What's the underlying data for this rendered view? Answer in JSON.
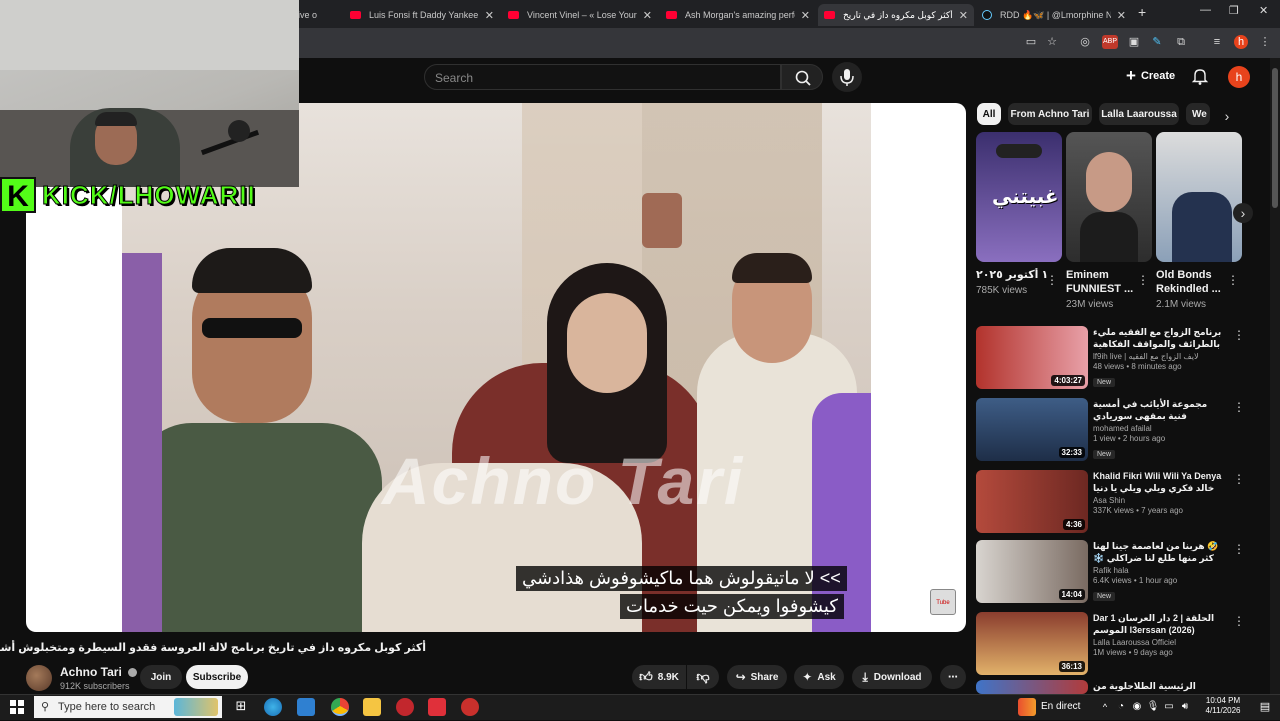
{
  "browser": {
    "tabs": [
      {
        "label": "ive o",
        "icon": "youtube-icon"
      },
      {
        "label": "Luis Fonsi ft Daddy Yankee – D",
        "icon": "youtube-icon"
      },
      {
        "label": "Vincent Vinel – « Lose Yourself",
        "icon": "youtube-icon"
      },
      {
        "label": "Ash Morgan's amazing perform",
        "icon": "youtube-icon"
      },
      {
        "label": "أكثر كوبل مكروه داز في تاريخ",
        "icon": "youtube-icon",
        "active": true
      },
      {
        "label": "RDD 🔥🦋 | @Lmorphine Next",
        "icon": "tiktok-icon"
      }
    ],
    "new_tab": "+",
    "window_controls": {
      "minimize": "—",
      "maximize": "❐",
      "close": "✕"
    }
  },
  "youtube": {
    "search_placeholder": "Search",
    "create_label": "Create",
    "avatar_letter": "h"
  },
  "webcam": {
    "kick_logo": "K",
    "kick_text": "KICK/LHOWARII"
  },
  "player": {
    "watermark": "Achno Tari",
    "subtitle_line1": ">> لا ماتيقولوش هما ماكيشوفوش هذادشي",
    "subtitle_line2": "كيشوفوا ويمكن حيت خدمات",
    "badge": "Tube"
  },
  "video": {
    "title": "أكثر كوبل مكروه داز في تاريخ برنامج لالة العروسة فقدو السيطرة ومتخبلوش أشنو داروا",
    "channel": "Achno Tari",
    "subscribers": "912K subscribers",
    "join_label": "Join",
    "subscribe_label": "Subscribe",
    "likes": "8.9K",
    "share_label": "Share",
    "ask_label": "Ask",
    "download_label": "Download",
    "more_label": "⋯"
  },
  "chips": [
    "All",
    "From Achno Tari",
    "Lalla Laaroussa",
    "We"
  ],
  "shorts": [
    {
      "thumb_text": "غبيتني",
      "title": "١ أكتوبر ٢٠٢٥",
      "views": "785K views"
    },
    {
      "title": "Eminem FUNNIEST ...",
      "views": "23M views"
    },
    {
      "title": "Old Bonds Rekindled ...",
      "views": "2.1M views"
    }
  ],
  "recommendations": [
    {
      "title": "برنامج الزواج مع الفقيه مليء بالطرائف والمواقف الفكاهية",
      "channel": "lf9ih live | لايف الزواج مع الفقيه",
      "views": "48 views • 8 minutes ago",
      "duration": "4:03:27",
      "badge": "New"
    },
    {
      "title": "مجموعة الأيائب في أمسية فنية بمقهى سوريادي الثقافي تطوان",
      "channel": "mohamed afailal",
      "views": "1 view • 2 hours ago",
      "duration": "32:33",
      "badge": "New"
    },
    {
      "title": "Khalid Fikri Wili Wili Ya Denya خالد فكري ويلي ويلي يا دنيا",
      "channel": "Asa Shin",
      "views": "337K views • 7 years ago",
      "duration": "4:36",
      "badge": ""
    },
    {
      "title": "🤣 هربنا من لعاصمة جينا لهنا كثر منها طلع لنا ضراكلي ❄️",
      "channel": "Rafik hala",
      "views": "6.4K views • 1 hour ago",
      "duration": "14:04",
      "badge": "New"
    },
    {
      "title": "Dar 1 الحلقة | 2 دار العرسان الموسم l3erssan (2026)",
      "channel": "Lalla Laaroussa Officiel",
      "views": "1M views • 9 days ago",
      "duration": "36:13",
      "badge": ""
    },
    {
      "title": "الرئيسية الطلاجلوية من التومة فاتيك نوك",
      "channel": "",
      "views": "",
      "duration": "",
      "badge": ""
    }
  ],
  "taskbar": {
    "search_placeholder": "Type here to search",
    "status": "En direct",
    "time": "10:04 PM",
    "date": "4/11/2026"
  }
}
